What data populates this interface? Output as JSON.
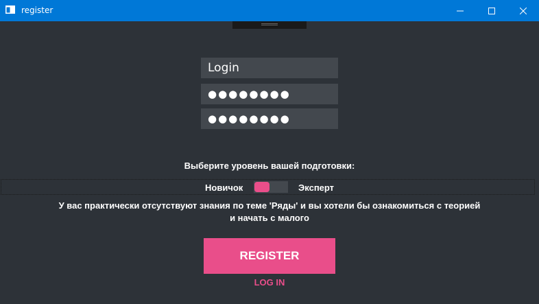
{
  "window": {
    "title": "register",
    "icon": "app-window-icon"
  },
  "form": {
    "login_value": "Login",
    "password_value": "●●●●●●●●",
    "password_confirm_value": "●●●●●●●●"
  },
  "level": {
    "heading": "Выберите уровень вашей подготовки:",
    "left_label": "Новичок",
    "right_label": "Эксперт",
    "selected": "Новичок",
    "description": "У вас практически отсутствуют знания по теме 'Ряды' и вы хотели бы ознакомиться с теорией и начать с малого"
  },
  "actions": {
    "register_label": "REGISTER",
    "login_label": "LOG IN"
  },
  "colors": {
    "accent": "#e94e8a",
    "background": "#2d3238",
    "field": "#43484e",
    "titlebar": "#0078d7"
  }
}
